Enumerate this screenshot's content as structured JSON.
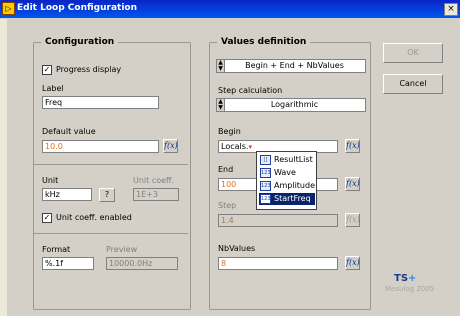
{
  "window": {
    "title": "Edit Loop Configuration",
    "close_label": "×",
    "title_icon": "▷"
  },
  "configuration": {
    "group_title": "Configuration",
    "progress_display_label": "Progress display",
    "progress_display_checked": "✓",
    "label_caption": "Label",
    "label_value": "Freq",
    "default_value_caption": "Default value",
    "default_value": "10.0",
    "unit_caption": "Unit",
    "unit_value": "kHz",
    "unit_help": "?",
    "unit_coeff_caption": "Unit coeff.",
    "unit_coeff_value": "1E+3",
    "unit_coeff_enabled_label": "Unit coeff. enabled",
    "unit_coeff_enabled_checked": "✓",
    "format_caption": "Format",
    "format_value": "%.1f",
    "preview_caption": "Preview",
    "preview_value": "10000.0Hz"
  },
  "values": {
    "group_title": "Values definition",
    "mode_value": "Begin + End + NbValues",
    "step_calc_caption": "Step calculation",
    "step_calc_value": "Logarithmic",
    "begin_caption": "Begin",
    "begin_value": "Locals.",
    "end_caption": "End",
    "end_value": "100",
    "step_caption": "Step",
    "step_value": "1.4",
    "nbvalues_caption": "NbValues",
    "nbvalues_value": "8",
    "fx_label": "f(x)"
  },
  "popup": {
    "items": [
      {
        "label": "ResultList",
        "icon": "[]"
      },
      {
        "label": "Wave",
        "icon": "123"
      },
      {
        "label": "Amplitude",
        "icon": "123"
      },
      {
        "label": "StartFreq",
        "icon": "123"
      }
    ],
    "selected": "StartFreq"
  },
  "buttons": {
    "ok_label": "OK",
    "cancel_label": "Cancel"
  },
  "branding": {
    "logo_text": "TS",
    "logo_plus": "+",
    "footer": "Mesulog 2005"
  },
  "colors": {
    "titlebar": "#0058ee",
    "dialog_bg": "#d4d0c8",
    "highlight": "#0a246a",
    "orange_text": "#e07020"
  }
}
